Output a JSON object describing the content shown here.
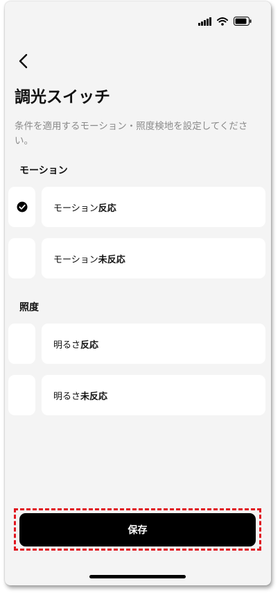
{
  "page": {
    "title": "調光スイッチ",
    "description": "条件を適用するモーション・照度検地を設定してください。"
  },
  "status_bar": {
    "icons": [
      "cellular-signal-icon",
      "wifi-icon",
      "battery-icon"
    ]
  },
  "nav": {
    "back_icon": "chevron-left-icon"
  },
  "sections": {
    "motion": {
      "label": "モーション",
      "options": [
        {
          "prefix": "モーション",
          "emphasis": "反応",
          "checked": true
        },
        {
          "prefix": "モーション",
          "emphasis": "未反応",
          "checked": false
        }
      ]
    },
    "illuminance": {
      "label": "照度",
      "options": [
        {
          "prefix": "明るさ",
          "emphasis": "反応",
          "checked": false
        },
        {
          "prefix": "明るさ",
          "emphasis": "未反応",
          "checked": false
        }
      ]
    }
  },
  "actions": {
    "save_label": "保存"
  },
  "colors": {
    "background": "#f4f4f4",
    "card": "#ffffff",
    "primary_button": "#000000",
    "highlight_border": "#e0141e",
    "secondary_text": "#8a8a8a"
  }
}
